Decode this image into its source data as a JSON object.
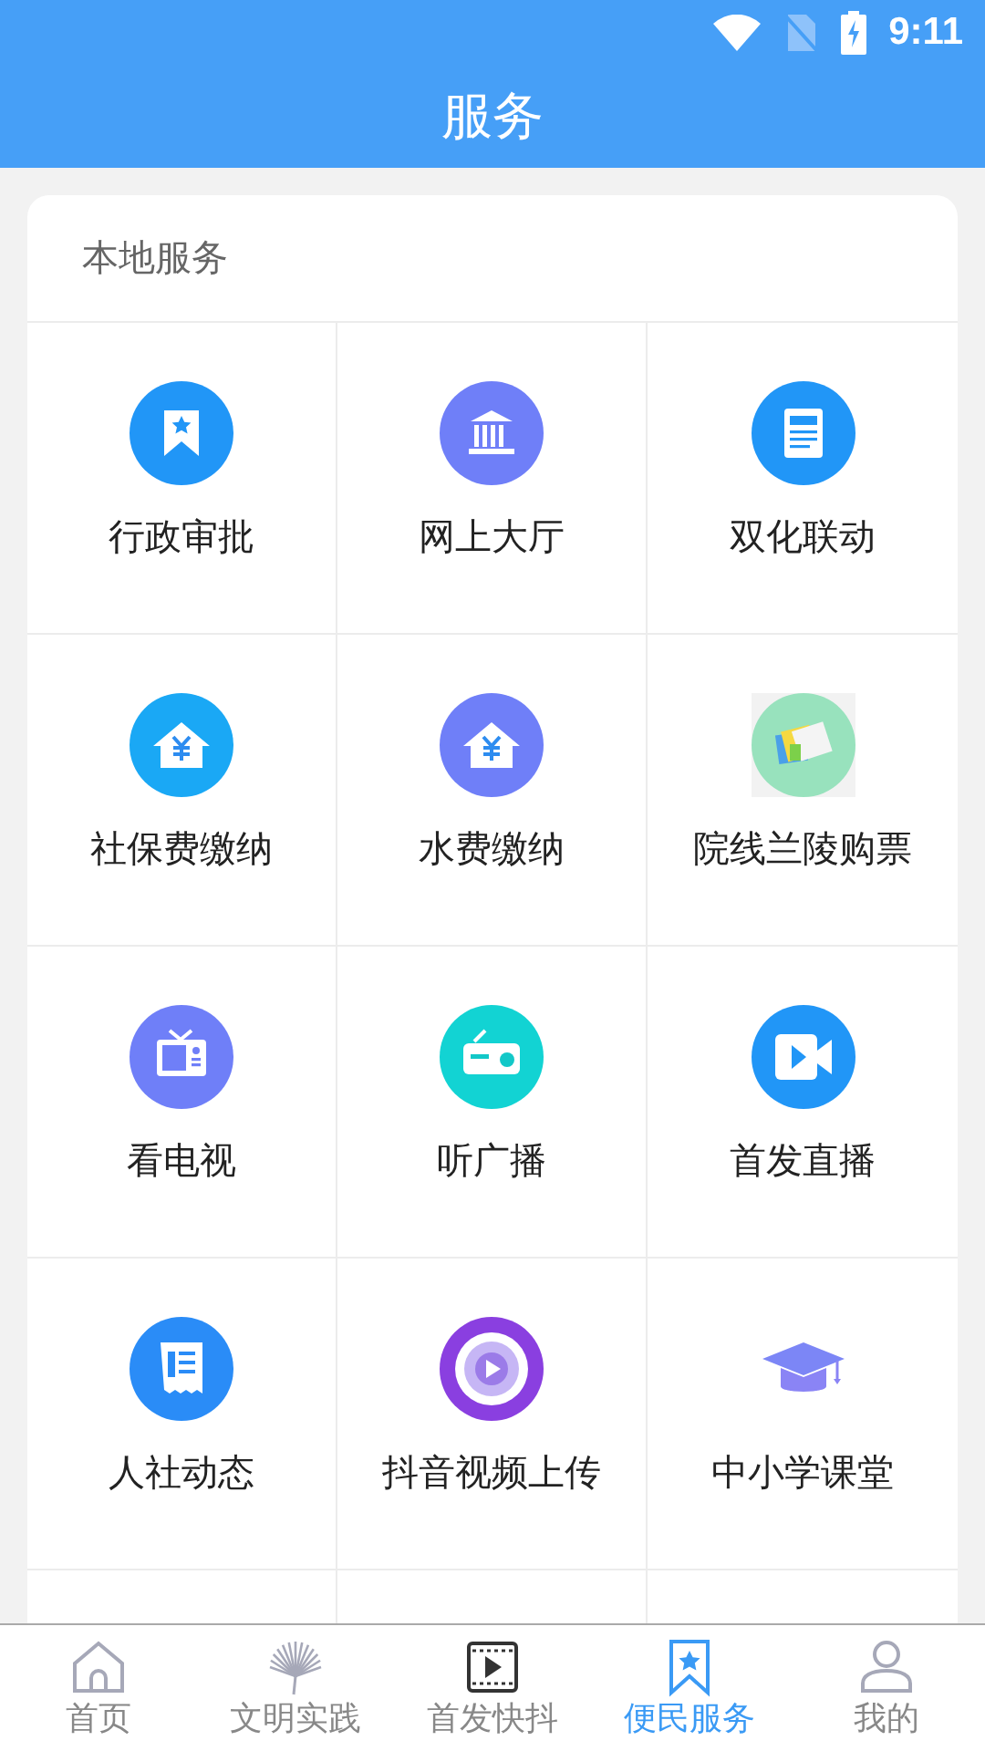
{
  "status_bar": {
    "time": "9:11"
  },
  "header": {
    "title": "服务"
  },
  "section": {
    "title": "本地服务",
    "items": [
      {
        "label": "行政审批",
        "kind": "bookmark",
        "color": "#2196f7"
      },
      {
        "label": "网上大厅",
        "kind": "bank",
        "color": "#6f7ff8"
      },
      {
        "label": "双化联动",
        "kind": "document",
        "color": "#2196f7"
      },
      {
        "label": "社保费缴纳",
        "kind": "house",
        "color": "#1aa8f5"
      },
      {
        "label": "水费缴纳",
        "kind": "house",
        "color": "#6f7ff8"
      },
      {
        "label": "院线兰陵购票",
        "kind": "tickets",
        "color": "#98e2bd"
      },
      {
        "label": "看电视",
        "kind": "tv",
        "color": "#6f7ff8"
      },
      {
        "label": "听广播",
        "kind": "radio",
        "color": "#12d3d3"
      },
      {
        "label": "首发直播",
        "kind": "camera",
        "color": "#2196f7"
      },
      {
        "label": "人社动态",
        "kind": "news",
        "color": "#2a8cf7"
      },
      {
        "label": "抖音视频上传",
        "kind": "disc",
        "color": "#8a3fe0"
      },
      {
        "label": "中小学课堂",
        "kind": "cap",
        "color": "#7c86f6"
      }
    ]
  },
  "tab_bar": [
    {
      "label": "首页",
      "kind": "home",
      "selected": false
    },
    {
      "label": "文明实践",
      "kind": "fan",
      "selected": false
    },
    {
      "label": "首发快抖",
      "kind": "film",
      "selected": false
    },
    {
      "label": "便民服务",
      "kind": "bookmark",
      "selected": true
    },
    {
      "label": "我的",
      "kind": "person",
      "selected": false
    }
  ]
}
